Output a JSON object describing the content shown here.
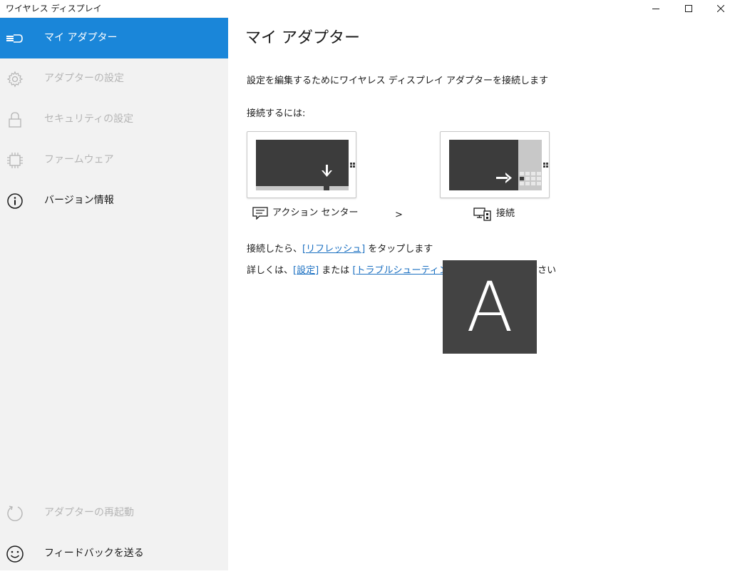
{
  "window": {
    "title": "ワイヤレス ディスプレイ",
    "minimize_icon": "minimize-icon",
    "maximize_icon": "maximize-icon",
    "close_icon": "close-icon"
  },
  "sidebar": {
    "items": [
      {
        "label": "マイ アダプター",
        "icon": "adapter-icon",
        "state": "selected"
      },
      {
        "label": "アダプターの設定",
        "icon": "gear-icon",
        "state": "disabled"
      },
      {
        "label": "セキュリティの設定",
        "icon": "lock-icon",
        "state": "disabled"
      },
      {
        "label": "ファームウェア",
        "icon": "chip-icon",
        "state": "disabled"
      },
      {
        "label": "バージョン情報",
        "icon": "info-icon",
        "state": "enabled"
      }
    ],
    "bottom_items": [
      {
        "label": "アダプターの再起動",
        "icon": "restart-icon",
        "state": "disabled"
      },
      {
        "label": "フィードバックを送る",
        "icon": "smiley-icon",
        "state": "enabled"
      }
    ]
  },
  "main": {
    "title": "マイ アダプター",
    "description": "設定を編集するためにワイヤレス ディスプレイ アダプターを接続します",
    "how_to_connect": "接続するには:",
    "step1_label": "アクション センター",
    "step_separator": ">",
    "step2_label": "接続",
    "after_connect_prefix": "接続したら、",
    "refresh_link": "[リフレッシュ]",
    "after_connect_suffix": " をタップします",
    "details_prefix": "詳しくは、",
    "settings_link": "[設定]",
    "details_or": " または ",
    "troubleshoot_link": "[トラブルシューティング]",
    "details_suffix": " をタップしてください"
  },
  "overlay": {
    "letter": "A",
    "bg_color": "#434343"
  },
  "colors": {
    "accent": "#1a86d9",
    "sidebar_bg": "#f2f2f2",
    "link": "#1a6fc1",
    "disabled_text": "#b5b5b5"
  }
}
